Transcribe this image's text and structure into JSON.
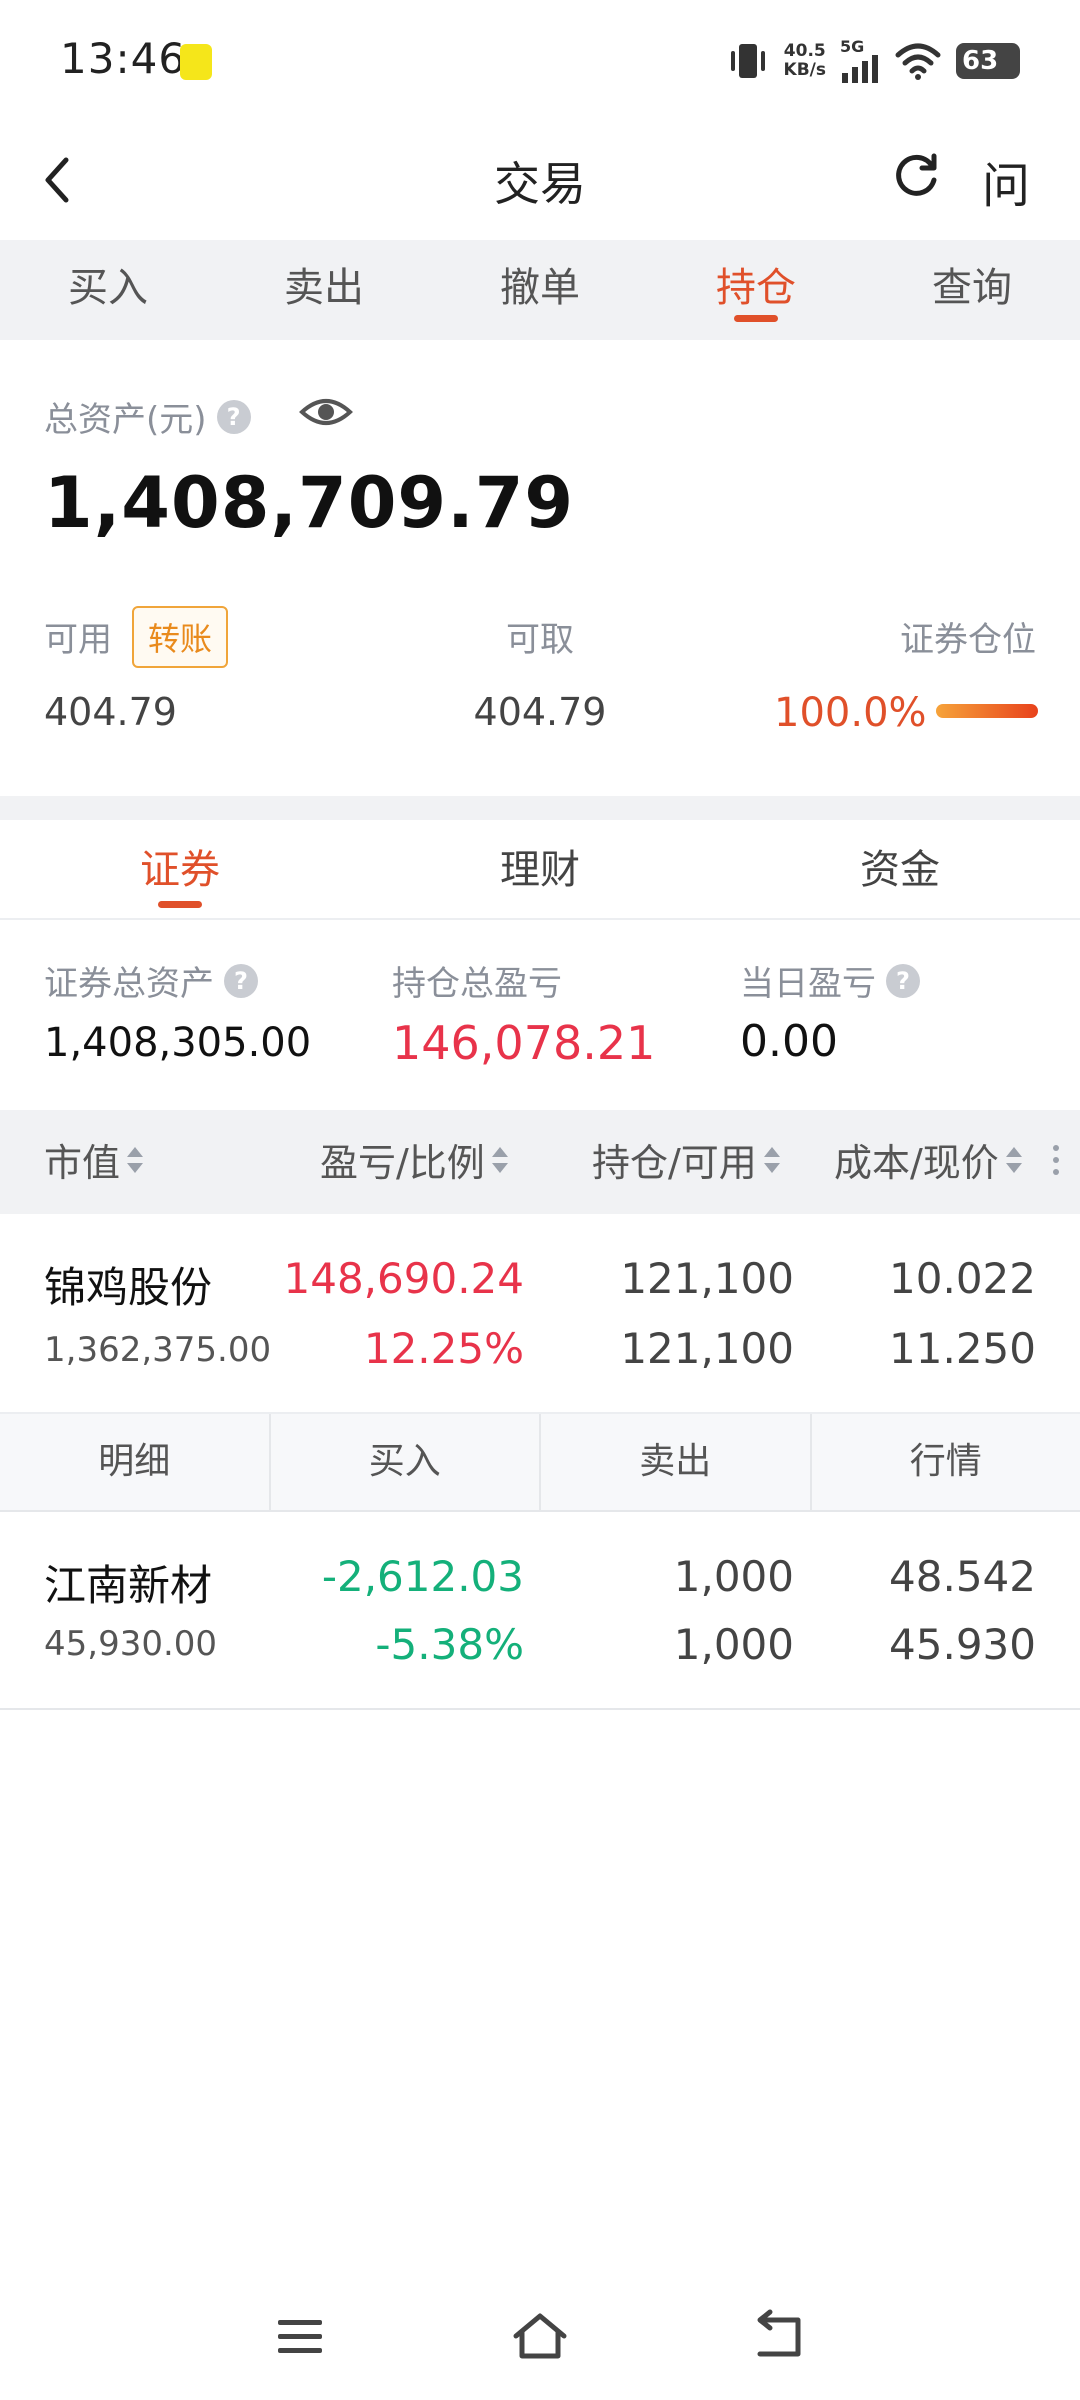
{
  "status_bar": {
    "time": "13:46",
    "net_speed_value": "40.5",
    "net_speed_unit": "KB/s",
    "network": "5G",
    "battery": "63"
  },
  "header": {
    "title": "交易",
    "ask_label": "问"
  },
  "main_tabs": [
    {
      "label": "买入",
      "active": false
    },
    {
      "label": "卖出",
      "active": false
    },
    {
      "label": "撤单",
      "active": false
    },
    {
      "label": "持仓",
      "active": true
    },
    {
      "label": "查询",
      "active": false
    }
  ],
  "assets": {
    "total_label": "总资产(元)",
    "total_value": "1,408,709.79",
    "available_label": "可用",
    "transfer_label": "转账",
    "available_value": "404.79",
    "withdrawable_label": "可取",
    "withdrawable_value": "404.79",
    "position_label": "证券仓位",
    "position_value": "100.0%",
    "position_fraction": 1.0
  },
  "sub_tabs": [
    {
      "label": "证券",
      "active": true
    },
    {
      "label": "理财",
      "active": false
    },
    {
      "label": "资金",
      "active": false
    }
  ],
  "securities_summary": {
    "total_assets_label": "证券总资产",
    "total_assets_value": "1,408,305.00",
    "total_pnl_label": "持仓总盈亏",
    "total_pnl_value": "146,078.21",
    "daily_pnl_label": "当日盈亏",
    "daily_pnl_value": "0.00"
  },
  "table_headers": [
    "市值",
    "盈亏/比例",
    "持仓/可用",
    "成本/现价"
  ],
  "holdings": [
    {
      "name": "锦鸡股份",
      "market_value": "1,362,375.00",
      "pnl": "148,690.24",
      "pnl_ratio": "12.25%",
      "position": "121,100",
      "available": "121,100",
      "cost": "10.022",
      "price": "11.250",
      "trend": "up"
    },
    {
      "name": "江南新材",
      "market_value": "45,930.00",
      "pnl": "-2,612.03",
      "pnl_ratio": "-5.38%",
      "position": "1,000",
      "available": "1,000",
      "cost": "48.542",
      "price": "45.930",
      "trend": "down"
    }
  ],
  "row_actions": [
    "明细",
    "买入",
    "卖出",
    "行情"
  ],
  "colors": {
    "accent": "#e0502a",
    "profit": "#e8334a",
    "loss": "#14b07a"
  }
}
